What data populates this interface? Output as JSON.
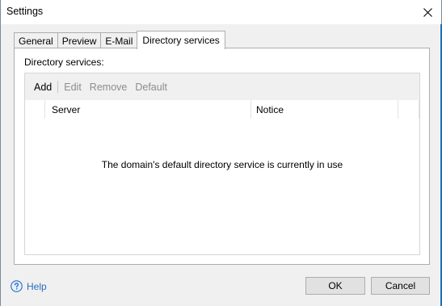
{
  "window": {
    "title": "Settings"
  },
  "tabs": [
    {
      "label": "General",
      "active": false
    },
    {
      "label": "Preview",
      "active": false
    },
    {
      "label": "E-Mail",
      "active": false
    },
    {
      "label": "Directory services",
      "active": true
    }
  ],
  "panel": {
    "group_label": "Directory services:",
    "toolbar": {
      "add": "Add",
      "edit": "Edit",
      "remove": "Remove",
      "default": "Default"
    },
    "columns": {
      "server": "Server",
      "notice": "Notice"
    },
    "empty_message": "The domain's default directory service is currently in use"
  },
  "footer": {
    "help": "Help",
    "ok": "OK",
    "cancel": "Cancel"
  },
  "colors": {
    "accent": "#1f6fb8",
    "link": "#2a6bbf",
    "disabled_text": "#8c8c8c"
  },
  "icons": {
    "close": "close-icon",
    "help": "help-icon"
  }
}
